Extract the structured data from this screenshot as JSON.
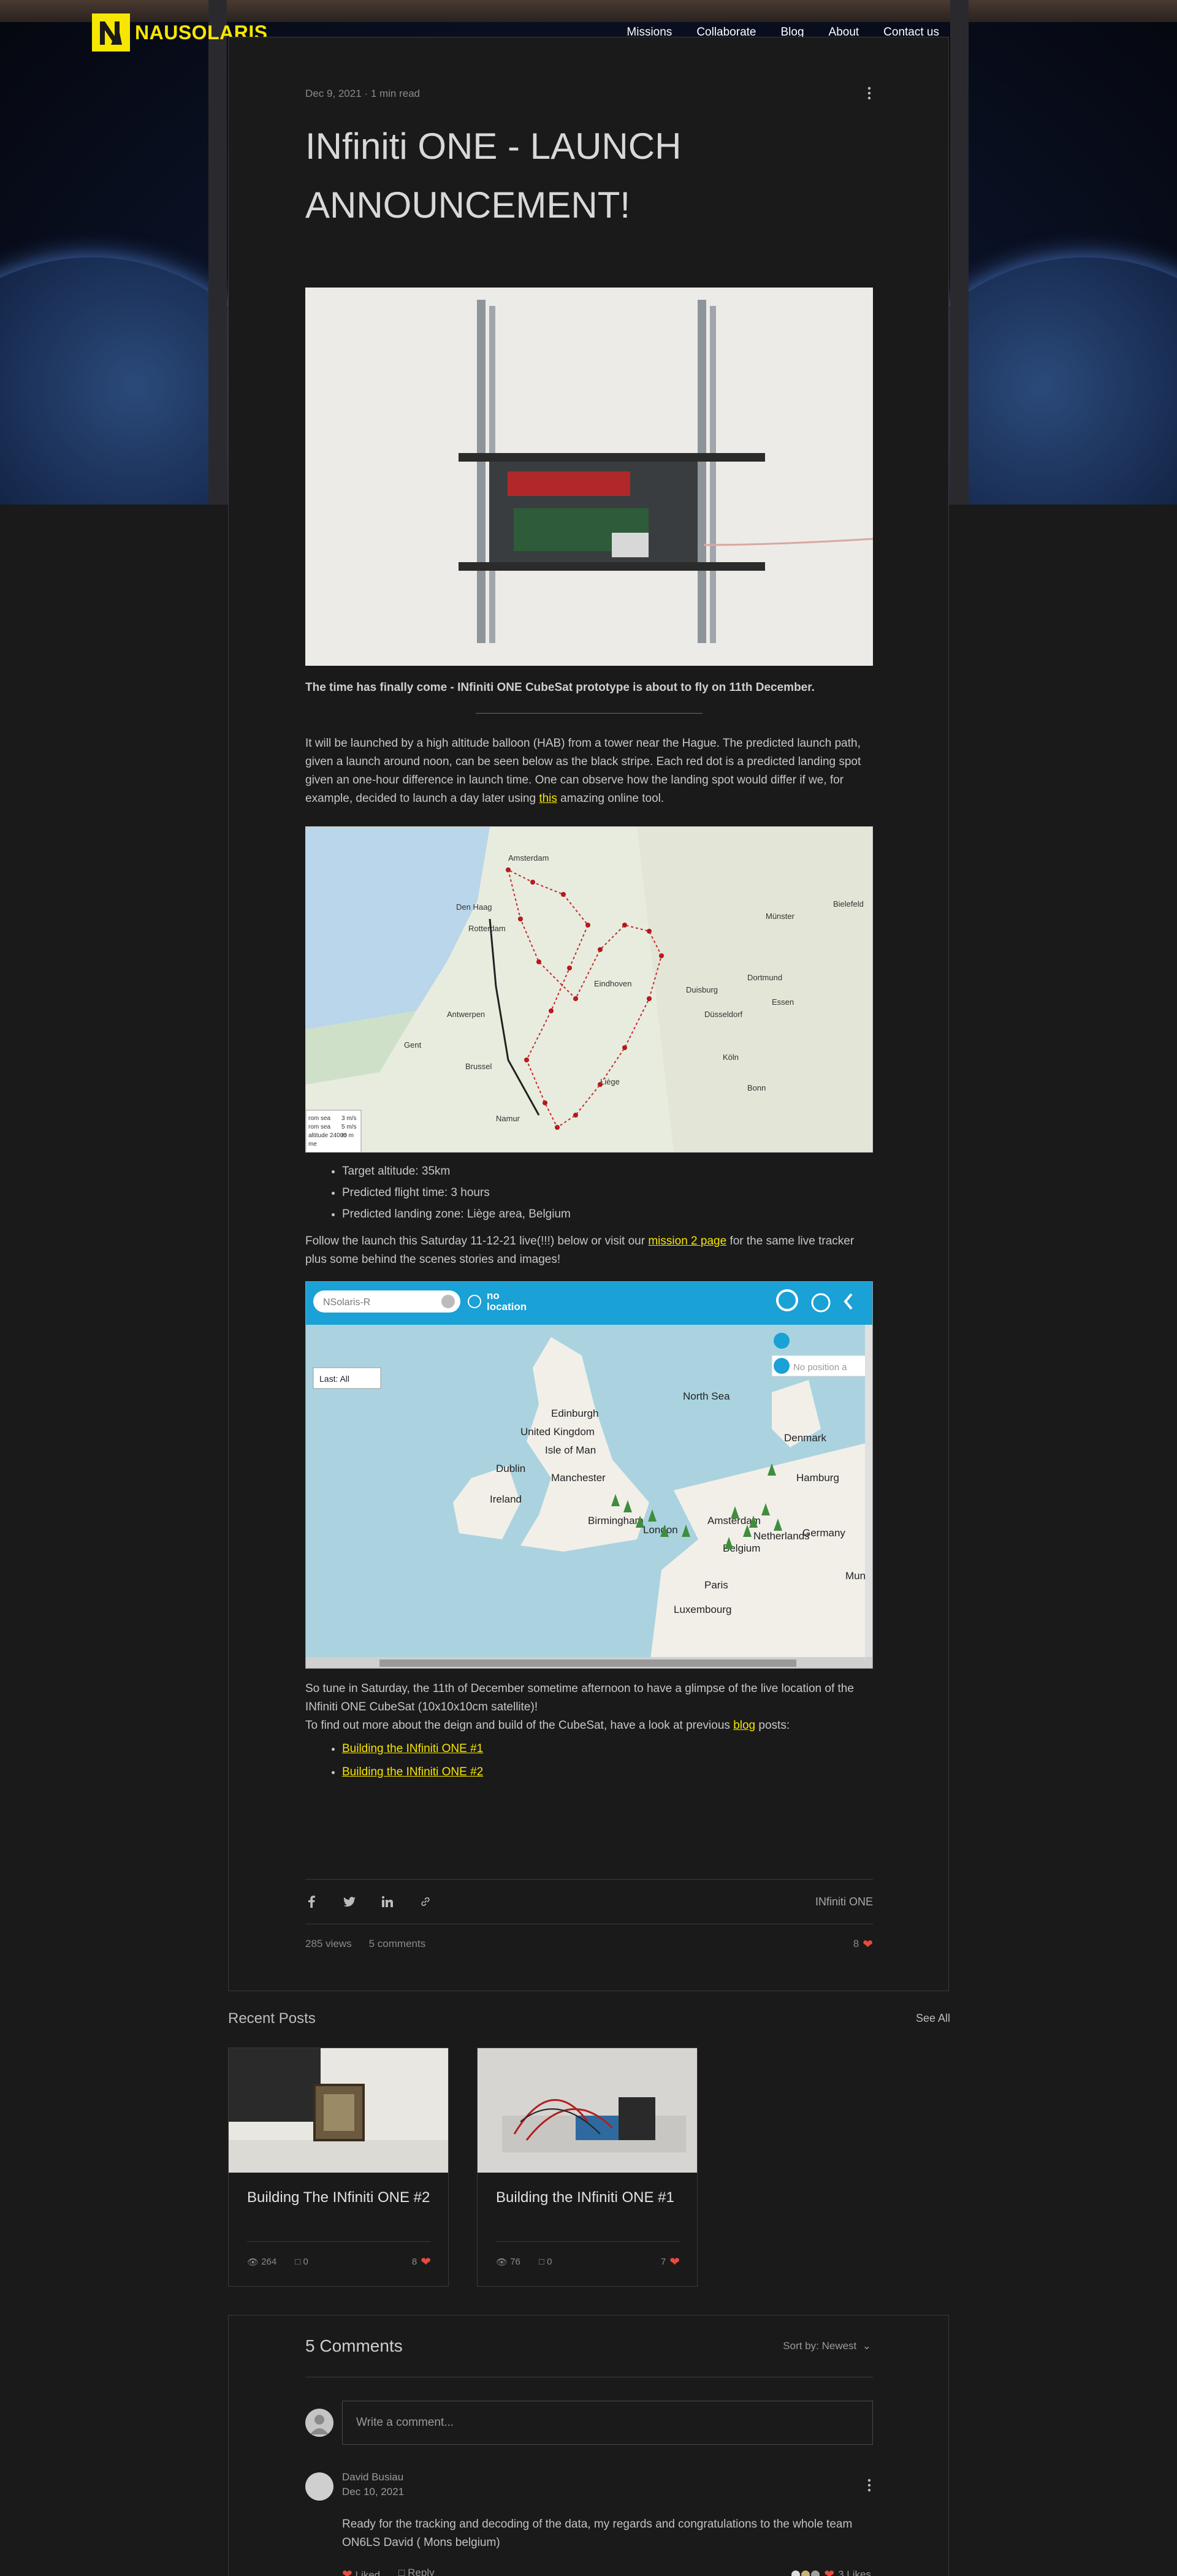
{
  "site": {
    "logo_text": "NAUSOLARIS",
    "nav": [
      "Missions",
      "Collaborate",
      "Blog",
      "About",
      "Contact us"
    ]
  },
  "post": {
    "date": "Dec 9, 2021",
    "read_time": "1 min read",
    "title_line1": "INfiniti ONE - LAUNCH",
    "title_line2": "ANNOUNCEMENT!",
    "lead": "The time has finally come -  INfiniti ONE CubeSat prototype is about to fly on 11th December.",
    "paragraph1_before": " It will be launched by a high altitude balloon (HAB) from a tower near the Hague. The predicted launch path, given a launch around noon, can be seen below as the black stripe. Each red dot is a predicted landing spot given an one-hour difference in launch time. One can observe how the landing spot would differ if we, for example, decided to launch a day later using ",
    "paragraph1_link": "this",
    "paragraph1_after": " amazing online tool.",
    "bullets": [
      "Target altitude: 35km",
      "Predicted flight time: 3 hours",
      "Predicted landing zone: Liège area, Belgium"
    ],
    "follow_before": "Follow the launch this Saturday 11-12-21 live(!!!) below or visit our ",
    "follow_link": "mission 2 page",
    "follow_after": " for the same live tracker plus some behind the scenes stories and images!",
    "tune_in": "So tune in Saturday, the 11th of December sometime afternoon to have a glimpse of the live location of the INfiniti ONE CubeSat (10x10x10cm satellite)!",
    "find_out_before": "To find out more about the deign and build of the CubeSat, have a look at previous ",
    "find_out_link": "blog",
    "find_out_after": " posts:",
    "links": [
      "Building the INfiniti ONE #1",
      "Building the INfiniti ONE #2"
    ],
    "tag": "INfiniti ONE",
    "views": "285 views",
    "comments": "5 comments",
    "likes": "8"
  },
  "map1": {
    "labels": [
      "Den Haag",
      "Amsterdam",
      "Rotterdam",
      "Antwerpen",
      "Gent",
      "Brussel",
      "Liège",
      "Namur",
      "Eindhoven",
      "Dortmund",
      "Düsseldorf",
      "Köln",
      "Bonn",
      "Duisburg",
      "Münster",
      "Bielefeld",
      "Essen"
    ],
    "info": [
      "rom sea",
      "rom sea",
      "altitude 24000 m",
      "me"
    ],
    "info_values": [
      "3 m/s",
      "5 m/s",
      "m",
      ""
    ]
  },
  "map2": {
    "search_placeholder": "NSolaris-R",
    "no_location": "no\nlocation",
    "last_label": "Last: All",
    "no_position": "No position a",
    "labels": [
      "Edinburgh",
      "United Kingdom",
      "Isle of Man",
      "Dublin",
      "Ireland",
      "Manchester",
      "Birmingham",
      "London",
      "Amsterdam",
      "Netherlands",
      "Belgium",
      "Luxembourg",
      "Paris",
      "Denmark",
      "Hamburg",
      "Germany",
      "North Sea",
      "Muni"
    ]
  },
  "recent": {
    "title": "Recent Posts",
    "see_all": "See All",
    "posts": [
      {
        "title": "Building The INfiniti ONE #2",
        "views": "264",
        "comments": "0",
        "likes": "8"
      },
      {
        "title": "Building the INfiniti ONE #1",
        "views": "76",
        "comments": "0",
        "likes": "7"
      }
    ]
  },
  "comments_section": {
    "title": "5 Comments",
    "sort": "Sort by: Newest",
    "write_placeholder": "Write a comment...",
    "author": "David Busiau",
    "date": "Dec 10, 2021",
    "text": "Ready for the tracking and decoding of the data, my regards and congratulations to the whole team ON6LS David ( Mons belgium)",
    "liked": "Liked",
    "reply": "Reply",
    "likes": "3 Likes"
  },
  "colors": {
    "accent": "#f7e600",
    "heart": "#e64b3c",
    "background": "#1a1a1a"
  }
}
